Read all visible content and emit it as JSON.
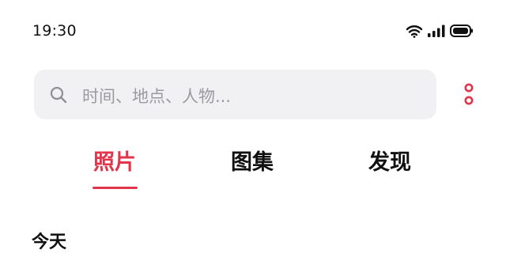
{
  "status_bar": {
    "time": "19:30",
    "icons": [
      "wifi-icon",
      "cellular-signal-icon",
      "battery-icon"
    ]
  },
  "search": {
    "icon": "search-icon",
    "placeholder": "时间、地点、人物..."
  },
  "more_menu": {
    "icon": "more-options-icon"
  },
  "tabs": [
    {
      "label": "照片",
      "active": true
    },
    {
      "label": "图集",
      "active": false
    },
    {
      "label": "发现",
      "active": false
    }
  ],
  "section": {
    "title": "今天"
  },
  "colors": {
    "accent": "#e2344a",
    "search_background": "#f1f1f3",
    "placeholder_text": "#9a9a9f",
    "text": "#111111"
  }
}
